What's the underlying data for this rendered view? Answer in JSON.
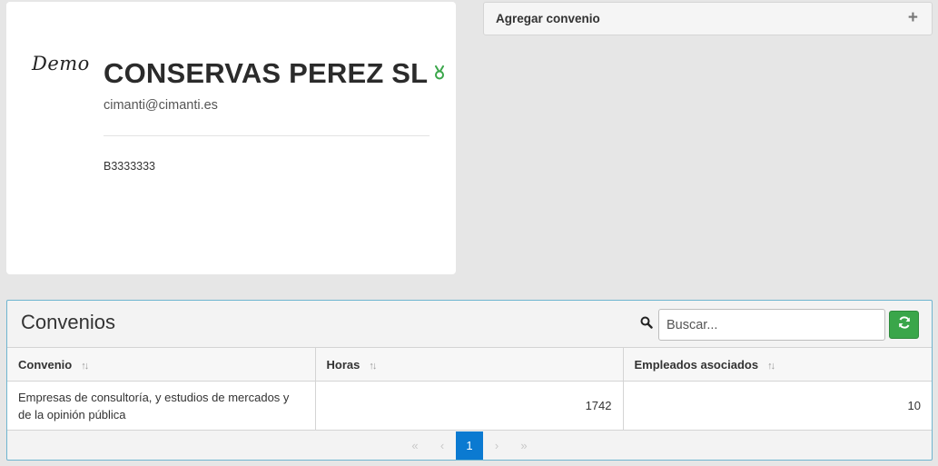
{
  "company": {
    "logo_text": "Demo",
    "name": "CONSERVAS PEREZ SL",
    "email": "cimanti@cimanti.es",
    "cif": "B3333333",
    "badge_icon": "medal-icon",
    "badge_color": "#3aa64a"
  },
  "add_panel": {
    "label": "Agregar convenio",
    "icon": "plus-icon"
  },
  "convenios": {
    "title": "Convenios",
    "search_placeholder": "Buscar...",
    "search_value": "",
    "refresh_color": "#3aa64a",
    "columns": [
      "Convenio",
      "Horas",
      "Empleados asociados"
    ],
    "rows": [
      {
        "convenio": "Empresas de consultoría, y estudios de mercados y de la opinión pública",
        "horas": "1742",
        "empleados": "10"
      }
    ],
    "pagination": {
      "first": "«",
      "prev": "‹",
      "current_page": "1",
      "next": "›",
      "last": "»",
      "active_color": "#0b7ad1"
    }
  }
}
